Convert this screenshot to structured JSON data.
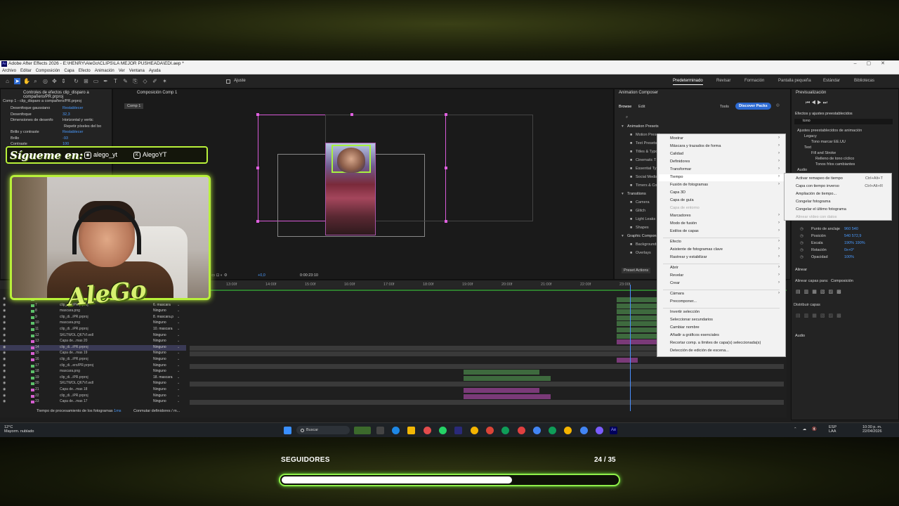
{
  "window": {
    "title": "Adobe After Effects 2026 - E:\\HENRY\\AleGo\\CLIPS\\LA MEJOR PUSHEADA\\EDI.aep *",
    "menu": [
      "Archivo",
      "Editar",
      "Composición",
      "Capa",
      "Efecto",
      "Animación",
      "Ver",
      "Ventana",
      "Ayuda"
    ]
  },
  "toolbar": {
    "snap_label": "Ajuste",
    "workspaces": [
      "Predeterminado",
      "Revisar",
      "Formación",
      "Pantalla pequeña",
      "Estándar",
      "Bibliotecas"
    ],
    "active_workspace": "Predeterminado"
  },
  "effects_panel": {
    "tab": "Controles de efectos clip_disparo a compañero/PR.prproj",
    "subtitle": "Comp 1 - clip_disparo a compañero/PR.prproj",
    "rows": [
      {
        "name": "Desenfoque gaussiano",
        "value": "Restablecer"
      },
      {
        "name": "Desenfoque",
        "value": "32,3"
      },
      {
        "name": "Dimensiones de desenfo",
        "value": "Horizontal y vertic"
      },
      {
        "name": "",
        "value": "Repetir píxeles del bo"
      },
      {
        "name": "Brillo y contraste",
        "value": "Restablecer"
      },
      {
        "name": "Brillo",
        "value": "-93"
      },
      {
        "name": "Contraste",
        "value": "100"
      }
    ]
  },
  "composition": {
    "tab": "Composición Comp 1",
    "breadcrumb": "Comp 1",
    "footer_zoom": "+0,0",
    "footer_time": "0:00:23:10"
  },
  "animation_composer": {
    "title": "Animation Composer",
    "tabs": [
      "Browse",
      "Edit"
    ],
    "tools": "Tools",
    "discover": "Discover Packs",
    "sections": [
      "Animation Presets",
      "Motion Presets",
      "Text Presets",
      "Titles & Typography",
      "Cinematic T",
      "Essential Ty",
      "Social Media",
      "Timers & Co",
      "Transitions",
      "Camera",
      "Glitch",
      "Light Leaks",
      "Shapes",
      "Graphic Compon",
      "Backgrounds",
      "Overlays"
    ],
    "preset_actions": "Preset Actions"
  },
  "context_menu": {
    "items": [
      {
        "label": "Mostrar",
        "arrow": true,
        "disabled": false
      },
      {
        "label": "Máscara y trazados de forma",
        "arrow": true,
        "disabled": false
      },
      {
        "label": "Calidad",
        "arrow": true,
        "disabled": false
      },
      {
        "label": "Definidores",
        "arrow": true,
        "disabled": false
      },
      {
        "label": "Transformar",
        "arrow": true,
        "disabled": false
      },
      {
        "label": "Tiempo",
        "arrow": true,
        "disabled": false
      },
      {
        "label": "Fusión de fotogramas",
        "arrow": true,
        "disabled": false
      },
      {
        "label": "Capa 3D",
        "arrow": false,
        "disabled": false
      },
      {
        "label": "Capa de guía",
        "arrow": false,
        "disabled": false
      },
      {
        "label": "Capa de entorno",
        "arrow": false,
        "disabled": true
      },
      {
        "label": "Marcadores",
        "arrow": true,
        "disabled": false
      },
      {
        "label": "Modo de fusión",
        "arrow": true,
        "disabled": false
      },
      {
        "label": "Estilos de capas",
        "arrow": true,
        "disabled": false
      },
      {
        "label": "Efecto",
        "arrow": true,
        "disabled": false
      },
      {
        "label": "Asistente de fotogramas clave",
        "arrow": true,
        "disabled": false
      },
      {
        "label": "Rastrear y estabilizar",
        "arrow": true,
        "disabled": false
      },
      {
        "label": "Abrir",
        "arrow": true,
        "disabled": false
      },
      {
        "label": "Revelar",
        "arrow": true,
        "disabled": false
      },
      {
        "label": "Crear",
        "arrow": true,
        "disabled": false
      },
      {
        "label": "Cámara",
        "arrow": true,
        "disabled": false
      },
      {
        "label": "Precomponer...",
        "arrow": false,
        "disabled": false
      },
      {
        "label": "Invertir selección",
        "arrow": false,
        "disabled": false
      },
      {
        "label": "Seleccionar secundarios",
        "arrow": false,
        "disabled": false
      },
      {
        "label": "Cambiar nombre",
        "arrow": false,
        "disabled": false
      },
      {
        "label": "Añadir a gráficos esenciales",
        "arrow": false,
        "disabled": false
      },
      {
        "label": "Recortar comp. a límites de capa(s) seleccionada(s)",
        "arrow": false,
        "disabled": false
      },
      {
        "label": "Detección de edición de escena...",
        "arrow": false,
        "disabled": false
      }
    ]
  },
  "submenu": {
    "items": [
      {
        "label": "Activar remapeo de tiempo",
        "shortcut": "Ctrl+Alt+T",
        "disabled": false
      },
      {
        "label": "Capa con tiempo inverso",
        "shortcut": "Ctrl+Alt+R",
        "disabled": false
      },
      {
        "label": "Ampliación de tiempo...",
        "shortcut": "",
        "disabled": false
      },
      {
        "label": "Congelar fotograma",
        "shortcut": "",
        "disabled": false
      },
      {
        "label": "Congelar el último fotograma",
        "shortcut": "",
        "disabled": false
      },
      {
        "label": "Alinear vídeo con datos",
        "shortcut": "",
        "disabled": true
      }
    ]
  },
  "right_panels": {
    "preview": "Previsualización",
    "effects_presets": "Efectos y ajustes preestablecidos",
    "search_value": "tono",
    "tree": [
      "Ajustes preestablecidos de animación",
      "Legacy",
      "Tono marcar EE.UU",
      "Text",
      "Fill and Stroke",
      "Relleno de tono cíclico",
      "Tonos frlos cambiantes",
      "Audio"
    ],
    "transform": [
      {
        "name": "Punto de anclaje",
        "value": "960    540"
      },
      {
        "name": "Posición",
        "value": "540    572,9"
      },
      {
        "name": "Escala",
        "value": "190%    190%"
      },
      {
        "name": "Rotación",
        "value": "0x+0°"
      },
      {
        "name": "Opacidad",
        "value": "100%"
      }
    ],
    "align": "Alinear",
    "align_to_label": "Alinear capas para:",
    "align_to_value": "Composición",
    "distribute": "Distribuir capas",
    "audio": "Audio"
  },
  "timeline": {
    "ruler": [
      "13:00f",
      "14:00f",
      "15:00f",
      "16:00f",
      "17:00f",
      "18:00f",
      "19:00f",
      "20:00f",
      "21:00f",
      "22:00f",
      "23:00f"
    ],
    "layers": [
      {
        "num": "6",
        "name": "mascara",
        "mode": "Ninguno",
        "color": "#5dc06a"
      },
      {
        "num": "7",
        "name": "clip_di...iPR.prproj",
        "mode": "6. mascara",
        "color": "#5dc06a"
      },
      {
        "num": "8",
        "name": "mascara.png",
        "mode": "Ninguno",
        "color": "#5dc06a"
      },
      {
        "num": "9",
        "name": "clip_di...iPR.prproj",
        "mode": "8. mascara.p",
        "color": "#5dc06a"
      },
      {
        "num": "10",
        "name": "mascara.png",
        "mode": "Ninguno",
        "color": "#5dc06a"
      },
      {
        "num": "11",
        "name": "clip_di...iPR.prproj",
        "mode": "10. mascara",
        "color": "#5dc06a"
      },
      {
        "num": "12",
        "name": "SKLTWOL.Q67VI.wdl",
        "mode": "Ninguno",
        "color": "#5dc06a"
      },
      {
        "num": "13",
        "name": "Capa de...mas 20",
        "mode": "Ninguno",
        "color": "#d65fd0"
      },
      {
        "num": "14",
        "name": "clip_di...iPR.prproj",
        "mode": "Ninguno",
        "color": "#d65fd0"
      },
      {
        "num": "15",
        "name": "Capa de...mas 19",
        "mode": "Ninguno",
        "color": "#d65fd0"
      },
      {
        "num": "16",
        "name": "clip_di...iPR.prproj",
        "mode": "Ninguno",
        "color": "#d65fd0"
      },
      {
        "num": "17",
        "name": "clip_di...ero/PR.prproj",
        "mode": "Ninguno",
        "color": "#5dc06a"
      },
      {
        "num": "18",
        "name": "mascara.png",
        "mode": "Ninguno",
        "color": "#5dc06a"
      },
      {
        "num": "19",
        "name": "clip_di...iPR.prproj",
        "mode": "18. mascara",
        "color": "#5dc06a"
      },
      {
        "num": "20",
        "name": "SKLTWOL.Q67VI.wdl",
        "mode": "Ninguno",
        "color": "#5dc06a"
      },
      {
        "num": "21",
        "name": "Capa de...mas 18",
        "mode": "Ninguno",
        "color": "#d65fd0"
      },
      {
        "num": "22",
        "name": "clip_di...iPR.prproj",
        "mode": "Ninguno",
        "color": "#d65fd0"
      },
      {
        "num": "23",
        "name": "Capa de...mas 17",
        "mode": "Ninguno",
        "color": "#d65fd0"
      }
    ],
    "status": "Tiempo de procesamiento de los fotogramas",
    "status_value": "1ms",
    "toggle_label": "Conmutar definidores / m..."
  },
  "taskbar": {
    "weather_temp": "12°C",
    "weather_desc": "Mayorm. nublado",
    "search_placeholder": "Buscar",
    "lang": "ESP",
    "lang2": "LAA",
    "time": "10:30 p. m.",
    "date": "22/04/2026"
  },
  "overlay": {
    "follow_title": "Sígueme en:",
    "instagram": "alego_yt",
    "kick": "AlegoYT",
    "brand": "AleGo"
  },
  "goal": {
    "label": "SEGUIDORES",
    "count_text": "24 / 35",
    "current": 24,
    "target": 35
  },
  "colors": {
    "accent_green": "#b8f03a",
    "layer_green": "#5dc06a",
    "layer_pink": "#d65fd0",
    "ae_blue": "#2d6ad1"
  }
}
